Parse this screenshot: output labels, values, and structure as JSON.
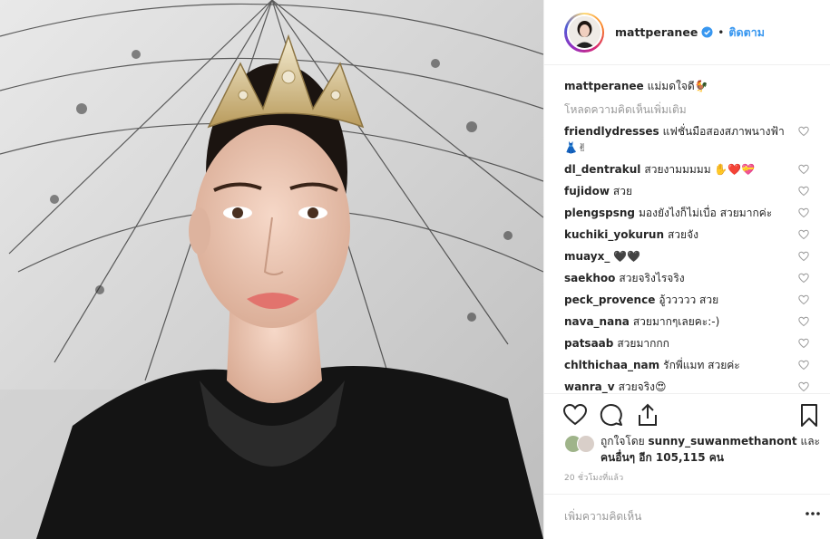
{
  "post": {
    "author": "mattperanee",
    "dot": "•",
    "follow_label": "ติดตาม",
    "caption_user": "mattperanee",
    "caption_text": "แม่มดใจดี🐓",
    "load_more": "โหลดความคิดเห็นเพิ่มเติม"
  },
  "comments": [
    {
      "user": "friendlydresses",
      "text": "แฟชั่นมือสองสภาพนางฟ้า 👗✌"
    },
    {
      "user": "dl_dentrakul",
      "text": "สวยงามมมมม ✋❤️💝"
    },
    {
      "user": "fujidow",
      "text": "สวย"
    },
    {
      "user": "plengspsng",
      "text": "มองยังไงก็ไม่เบื่อ สวยมากค่ะ"
    },
    {
      "user": "kuchiki_yokurun",
      "text": "สวยจัง"
    },
    {
      "user": "muayx_",
      "text": "🖤🖤"
    },
    {
      "user": "saekhoo",
      "text": "สวยจริงไรจริง"
    },
    {
      "user": "peck_provence",
      "text": "อู้ววววว สวย"
    },
    {
      "user": "nava_nana",
      "text": "สวยมากๆเลยคะ:-)"
    },
    {
      "user": "patsaab",
      "text": "สวยมากกก"
    },
    {
      "user": "chlthichaa_nam",
      "text": "รักพี่แมท สวยค่ะ"
    },
    {
      "user": "wanra_v",
      "text": "สวยจริง😍"
    }
  ],
  "likes": {
    "prefix": "ถูกใจโดย",
    "user": "sunny_suwanmethanont",
    "middle": "และ",
    "others": "คนอื่นๆ อีก 105,115 คน"
  },
  "timestamp": "20 ชั่วโมงที่แล้ว",
  "add_comment": {
    "placeholder": "เพิ่มความคิดเห็น"
  },
  "colors": {
    "accent": "#3897f0",
    "muted": "#999999",
    "text": "#262626",
    "border": "#efefef"
  },
  "icons": [
    "heart-icon",
    "comment-icon",
    "share-icon",
    "bookmark-icon",
    "verified-badge-icon",
    "more-options-icon"
  ]
}
